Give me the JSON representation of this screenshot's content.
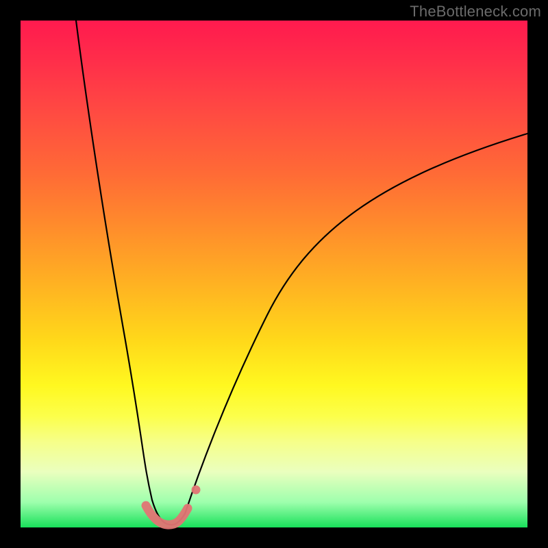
{
  "watermark": "TheBottleneck.com",
  "chart_data": {
    "type": "line",
    "title": "",
    "xlabel": "",
    "ylabel": "",
    "xlim": [
      0,
      100
    ],
    "ylim": [
      0,
      100
    ],
    "grid": false,
    "legend": false,
    "background_gradient": {
      "direction": "top-to-bottom",
      "stops": [
        {
          "pct": 0,
          "color": "#ff1a4e"
        },
        {
          "pct": 40,
          "color": "#ff8a2c"
        },
        {
          "pct": 72,
          "color": "#fff820"
        },
        {
          "pct": 100,
          "color": "#18e05a"
        }
      ]
    },
    "series": [
      {
        "name": "left_branch",
        "x": [
          11,
          13,
          15,
          17,
          19,
          21,
          23,
          25,
          26
        ],
        "y": [
          100,
          84,
          68,
          52,
          36,
          22,
          12,
          5,
          2
        ]
      },
      {
        "name": "bottom_segment",
        "x": [
          26,
          27,
          28,
          29,
          30,
          31,
          32
        ],
        "y": [
          2,
          1,
          0.5,
          0.5,
          1,
          2,
          4
        ]
      },
      {
        "name": "right_branch",
        "x": [
          32,
          35,
          40,
          48,
          58,
          70,
          85,
          100
        ],
        "y": [
          4,
          10,
          22,
          38,
          52,
          63,
          72,
          78
        ]
      }
    ],
    "annotations": [
      {
        "name": "salmon_band",
        "description": "short thick salmon stroke tracing the valley floor",
        "x": [
          24.5,
          26,
          28,
          30,
          31.5,
          33
        ],
        "y": [
          5,
          2,
          0.8,
          0.8,
          2,
          5
        ]
      },
      {
        "name": "salmon_dot",
        "x": 34.5,
        "y": 9
      }
    ]
  }
}
